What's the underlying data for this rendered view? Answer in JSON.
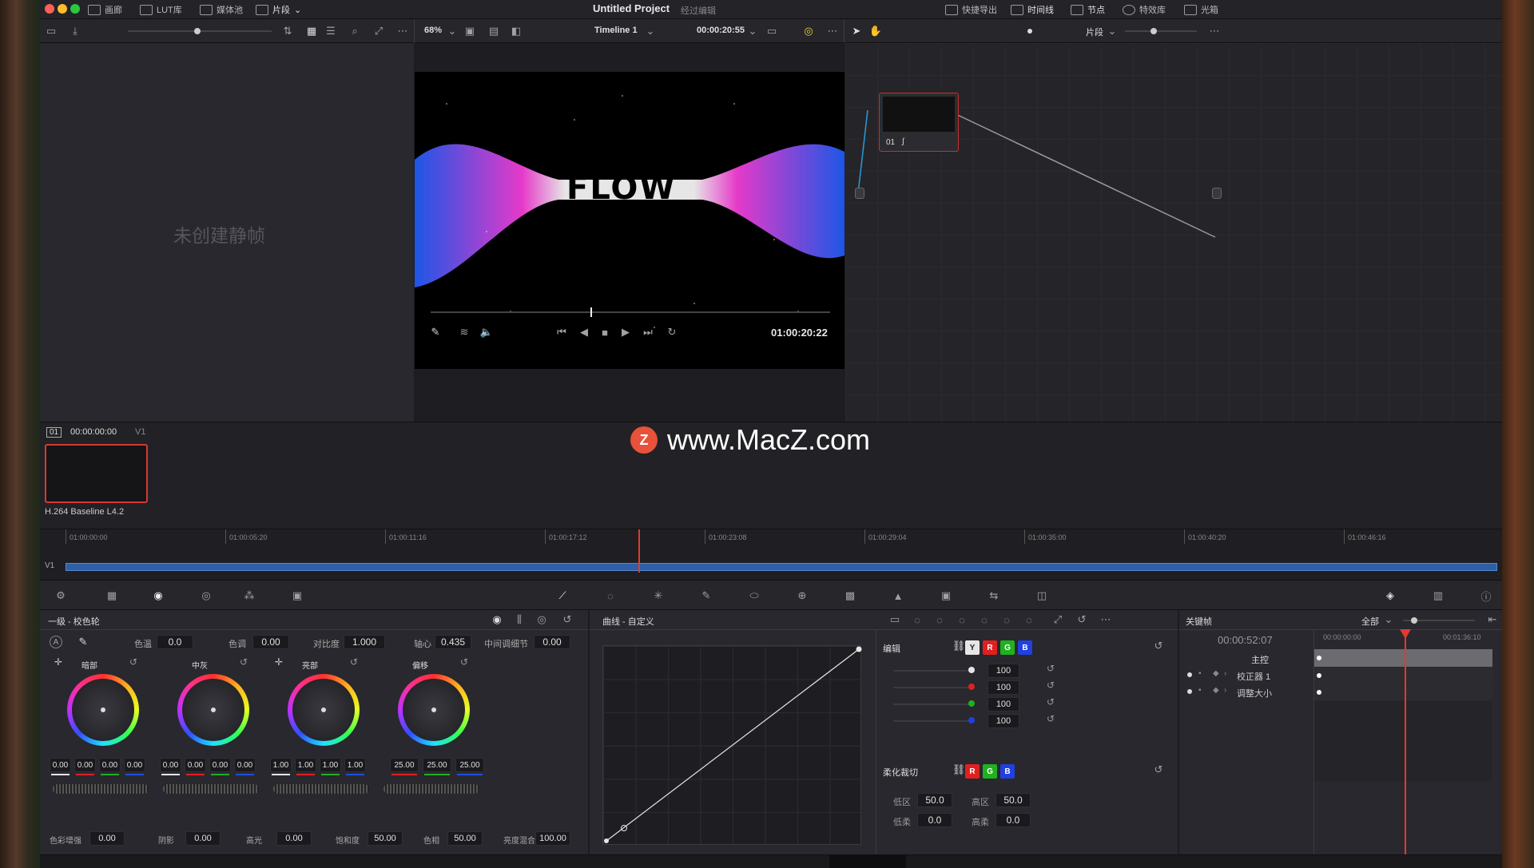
{
  "titlebar": {
    "project_title": "Untitled Project",
    "project_status": "经过编辑",
    "left_tabs": [
      "画廊",
      "LUT库",
      "媒体池",
      "片段"
    ],
    "right_tabs": [
      "快捷导出",
      "时间线",
      "节点",
      "特效库",
      "光箱"
    ]
  },
  "viewer_toolbar": {
    "zoom": "68%",
    "timeline_name": "Timeline 1",
    "timecode": "00:00:20:55",
    "node_mode": "片段"
  },
  "gallery": {
    "empty_text": "未创建静帧"
  },
  "viewer": {
    "flow_text": "FLOW",
    "playback_timecode": "01:00:20:22",
    "watermark": "www.MacZ.com",
    "watermark_icon": "Z"
  },
  "node_graph": {
    "node_label": "01"
  },
  "clip_strip": {
    "clip_number": "01",
    "clip_timecode": "00:00:00:00",
    "track": "V1",
    "codec": "H.264 Baseline L4.2"
  },
  "mini_timeline": {
    "track_label": "V1",
    "ticks": [
      "01:00:00:00",
      "01:00:05:20",
      "01:00:11:16",
      "01:00:17:12",
      "01:00:23:08",
      "01:00:29:04",
      "01:00:35:00",
      "01:00:40:20",
      "01:00:46:16"
    ],
    "playhead_fraction": 0.4
  },
  "primaries": {
    "title": "一级 - 校色轮",
    "temp_label": "色温",
    "temp": "0.0",
    "tint_label": "色调",
    "tint": "0.00",
    "contrast_label": "对比度",
    "contrast": "1.000",
    "pivot_label": "轴心",
    "pivot": "0.435",
    "mid_detail_label": "中间调细节",
    "mid_detail": "0.00",
    "wheels": [
      {
        "name": "暗部",
        "values": [
          "0.00",
          "0.00",
          "0.00",
          "0.00"
        ]
      },
      {
        "name": "中灰",
        "values": [
          "0.00",
          "0.00",
          "0.00",
          "0.00"
        ]
      },
      {
        "name": "亮部",
        "values": [
          "1.00",
          "1.00",
          "1.00",
          "1.00"
        ]
      },
      {
        "name": "偏移",
        "values": [
          "25.00",
          "25.00",
          "25.00"
        ]
      }
    ],
    "bottom": [
      {
        "label": "色彩增强",
        "value": "0.00"
      },
      {
        "label": "阴影",
        "value": "0.00"
      },
      {
        "label": "高光",
        "value": "0.00"
      },
      {
        "label": "饱和度",
        "value": "50.00"
      },
      {
        "label": "色相",
        "value": "50.00"
      },
      {
        "label": "亮度混合",
        "value": "100.00"
      }
    ]
  },
  "curves": {
    "title": "曲线 - 自定义",
    "edit_label": "编辑",
    "channels": [
      "Y",
      "R",
      "G",
      "B"
    ],
    "channel_colors": [
      "#e6e6e6",
      "#e02020",
      "#20b020",
      "#2040e0"
    ],
    "intensities": [
      "100",
      "100",
      "100",
      "100"
    ],
    "soft_clip_label": "柔化裁切",
    "low_label": "低区",
    "low": "50.0",
    "high_label": "高区",
    "high": "50.0",
    "low_soft_label": "低柔",
    "low_soft": "0.0",
    "high_soft_label": "高柔",
    "high_soft": "0.0"
  },
  "keyframes": {
    "title": "关键帧",
    "filter": "全部",
    "timecode": "00:00:52:07",
    "start_tc": "00:00:00:00",
    "end_tc": "00:01:36:10",
    "rows": [
      "主控",
      "校正器 1",
      "调整大小"
    ]
  }
}
